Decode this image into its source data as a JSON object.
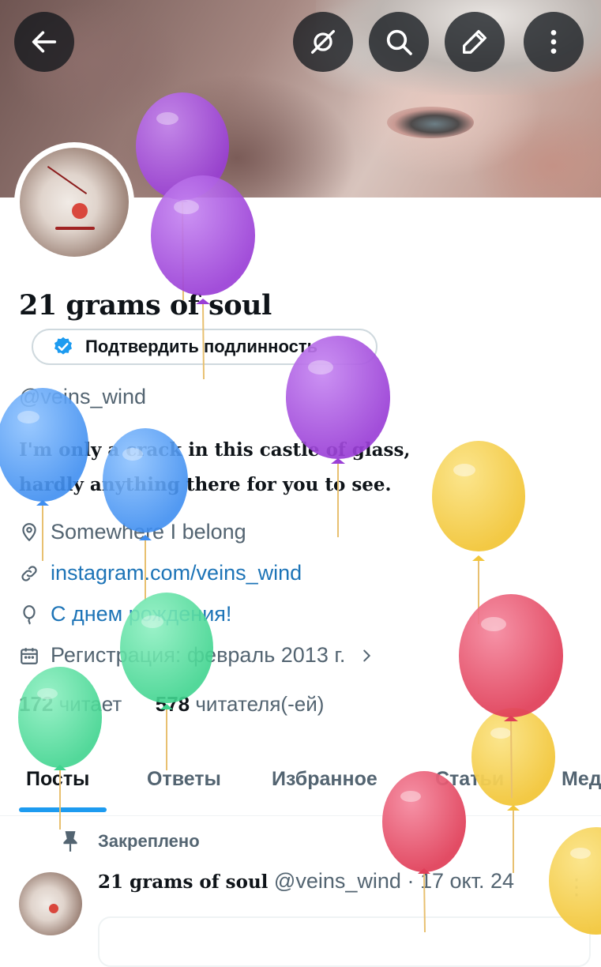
{
  "header": {
    "back_icon": "arrow-left-icon",
    "grok_icon": "grok-icon",
    "search_icon": "search-icon",
    "edit_icon": "edit-icon",
    "more_icon": "more-vertical-icon"
  },
  "profile": {
    "name": "21 grams of soul",
    "verify_button": "Подтвердить подлинность",
    "handle": "@veins_wind",
    "bio_line1": "I'm only a crack in this castle of glass,",
    "bio_line2": "hardly anything there for you to see.",
    "location": "Somewhere I belong",
    "website": "instagram.com/veins_wind",
    "birthday": "С днем рождения!",
    "joined": "Регистрация: февраль 2013 г.",
    "following_count": "172",
    "following_label": "читает",
    "followers_count": "578",
    "followers_label": "читателя(-ей)"
  },
  "tabs": [
    {
      "label": "Посты"
    },
    {
      "label": "Ответы"
    },
    {
      "label": "Избранное"
    },
    {
      "label": "Статьи"
    },
    {
      "label": "Медиа"
    }
  ],
  "post": {
    "pinned_label": "Закреплено",
    "author_name": "21 grams of soul",
    "author_handle": "@veins_wind",
    "separator": "·",
    "date": "17 окт. 24",
    "more": "⋮"
  },
  "colors": {
    "accent": "#1d9bf0",
    "link": "#1d74b7",
    "muted": "#536471",
    "balloon_purple": "#a24bd9",
    "balloon_blue": "#4d9cf0",
    "balloon_yellow": "#f4cf4a",
    "balloon_red": "#e84b64",
    "balloon_green": "#55dfa0"
  }
}
